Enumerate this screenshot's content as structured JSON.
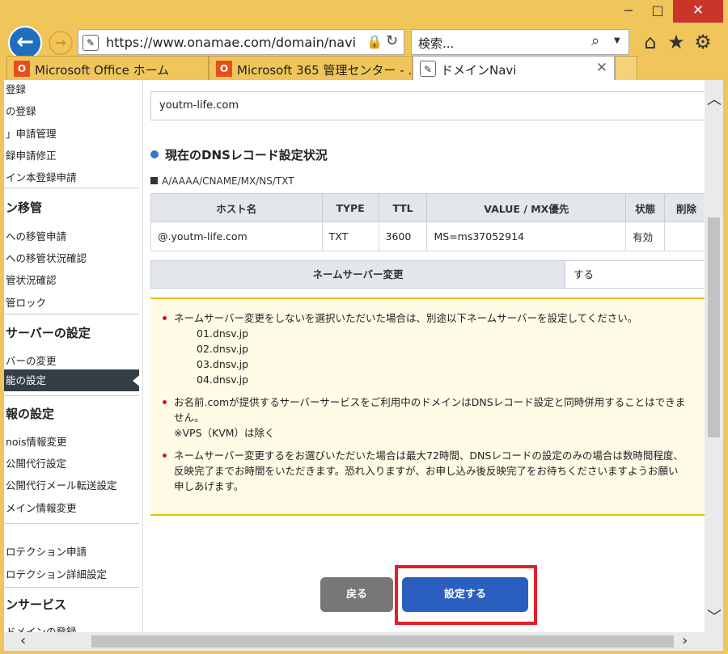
{
  "window": {
    "min": "−",
    "max": "□",
    "close": "✕"
  },
  "toolbar": {
    "back": "←",
    "forward": "→",
    "url": "https://www.onamae.com/domain/navi",
    "lock": "🔒",
    "reload": "↻",
    "search_placeholder": "検索...",
    "search_icon": "⌕",
    "home_icon": "⌂",
    "fav_icon": "★",
    "settings_icon": "⚙"
  },
  "tabs": [
    {
      "label": "Microsoft Office ホーム",
      "icon": "office-icon"
    },
    {
      "label": "Microsoft 365 管理センター - ...",
      "icon": "office-icon"
    },
    {
      "label": "ドメインNavi",
      "icon": "domain-navi-icon",
      "close": "✕"
    }
  ],
  "sidebar": {
    "items": [
      "登録",
      "の登録",
      "」申請管理",
      "録申請修正",
      "イン本登録申請"
    ],
    "head_transfer": "ン移管",
    "transfer_items": [
      "への移管申請",
      "への移管状況確認",
      "管状況確認",
      "管ロック"
    ],
    "head_server": "サーバーの設定",
    "server_items": [
      "バーの変更"
    ],
    "active_item": "能の設定",
    "head_info": "報の設定",
    "info_items": [
      "nois情報変更",
      "公開代行設定",
      "公開代行メール転送設定",
      "メイン情報変更"
    ],
    "protect_items": [
      "ロテクション申請",
      "ロテクション詳細設定"
    ],
    "head_service": "ンサービス",
    "service_items": [
      "ドメインの登録"
    ]
  },
  "main": {
    "domain": "youtm-life.com",
    "section_title": "現在のDNSレコード設定状況",
    "record_types": "A/AAAA/CNAME/MX/NS/TXT",
    "table": {
      "headers": [
        "ホスト名",
        "TYPE",
        "TTL",
        "VALUE / MX優先",
        "状態",
        "削除"
      ],
      "rows": [
        [
          "@.youtm-life.com",
          "TXT",
          "3600",
          "MS=ms37052914",
          "有効",
          ""
        ]
      ]
    },
    "ns_change_label": "ネームサーバー変更",
    "ns_change_value": "する",
    "notice": {
      "item1": "ネームサーバー変更をしないを選択いただいた場合は、別途以下ネームサーバーを設定してください。",
      "nameservers": [
        "01.dnsv.jp",
        "02.dnsv.jp",
        "03.dnsv.jp",
        "04.dnsv.jp"
      ],
      "item2_line1": "お名前.comが提供するサーバーサービスをご利用中のドメインはDNSレコード設定と同時併用することはできま",
      "item2_line2": "せん。",
      "item2_line3": "※VPS（KVM）は除く",
      "item3_line1": "ネームサーバー変更するをお選びいただいた場合は最大72時間、DNSレコードの設定のみの場合は数時間程度、",
      "item3_line2": "反映完了までお時間をいただきます。恐れ入りますが、お申し込み後反映完了をお待ちくださいますようお願い",
      "item3_line3": "申しあげます。"
    },
    "back_button": "戻る",
    "submit_button": "設定する"
  },
  "colors": {
    "chrome": "#f0c65a",
    "accent_blue": "#2a5fc0",
    "highlight_red": "#e0202a",
    "sidebar_active": "#333e48"
  }
}
